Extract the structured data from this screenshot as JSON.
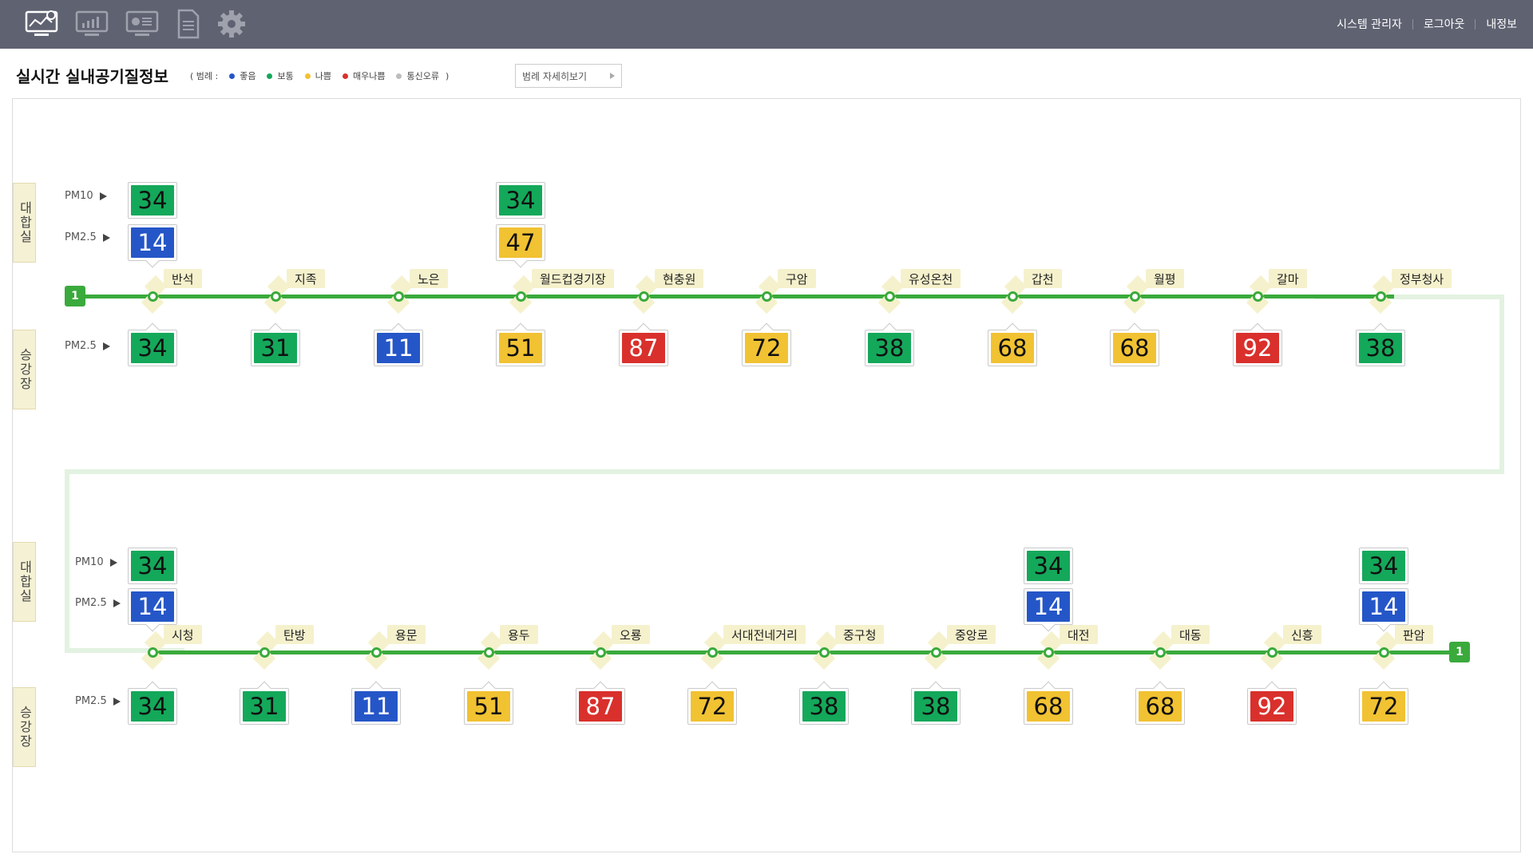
{
  "nav": {
    "icons": [
      "monitor-map-icon",
      "chart-icon",
      "dashboard-icon",
      "document-icon",
      "gear-icon"
    ],
    "user_menu": [
      "시스템 관리자",
      "로그아웃",
      "내정보"
    ]
  },
  "header": {
    "title": "실시간 실내공기질정보",
    "legend_open": "( 범례 :",
    "legend_close": ")",
    "legend": [
      {
        "label": "좋음",
        "color": "#2556c8"
      },
      {
        "label": "보통",
        "color": "#14a85a"
      },
      {
        "label": "나쁨",
        "color": "#f1c232"
      },
      {
        "label": "매우나쁨",
        "color": "#d9302c"
      },
      {
        "label": "통신오류",
        "color": "#bdbdbd"
      }
    ],
    "legend_button": "범례 자세히보기"
  },
  "grade_colors": {
    "good": {
      "bg": "#2556c8",
      "fg": "#ffffff"
    },
    "normal": {
      "bg": "#14a85a",
      "fg": "#111111"
    },
    "bad": {
      "bg": "#f1c232",
      "fg": "#111111"
    },
    "very_bad": {
      "bg": "#d9302c",
      "fg": "#ffffff"
    }
  },
  "labels": {
    "waiting_room": "대합실",
    "platform": "승강장",
    "pm10": "PM10",
    "pm25": "PM2.5",
    "line_number": "1"
  },
  "rows": [
    {
      "stations": [
        {
          "name": "반석",
          "pm10": {
            "v": "34",
            "g": "normal"
          },
          "pm25": {
            "v": "14",
            "g": "good"
          },
          "platform": {
            "v": "34",
            "g": "normal"
          }
        },
        {
          "name": "지족",
          "platform": {
            "v": "31",
            "g": "normal"
          }
        },
        {
          "name": "노은",
          "platform": {
            "v": "11",
            "g": "good"
          }
        },
        {
          "name": "월드컵경기장",
          "pm10": {
            "v": "34",
            "g": "normal"
          },
          "pm25": {
            "v": "47",
            "g": "bad"
          },
          "platform": {
            "v": "51",
            "g": "bad"
          }
        },
        {
          "name": "현충원",
          "platform": {
            "v": "87",
            "g": "very_bad"
          }
        },
        {
          "name": "구암",
          "platform": {
            "v": "72",
            "g": "bad"
          }
        },
        {
          "name": "유성온천",
          "platform": {
            "v": "38",
            "g": "normal"
          }
        },
        {
          "name": "갑천",
          "platform": {
            "v": "68",
            "g": "bad"
          }
        },
        {
          "name": "월평",
          "platform": {
            "v": "68",
            "g": "bad"
          }
        },
        {
          "name": "갈마",
          "platform": {
            "v": "92",
            "g": "very_bad"
          }
        },
        {
          "name": "정부청사",
          "platform": {
            "v": "38",
            "g": "normal"
          }
        }
      ]
    },
    {
      "stations": [
        {
          "name": "시청",
          "pm10": {
            "v": "34",
            "g": "normal"
          },
          "pm25": {
            "v": "14",
            "g": "good"
          },
          "platform": {
            "v": "34",
            "g": "normal"
          }
        },
        {
          "name": "탄방",
          "platform": {
            "v": "31",
            "g": "normal"
          }
        },
        {
          "name": "용문",
          "platform": {
            "v": "11",
            "g": "good"
          }
        },
        {
          "name": "용두",
          "platform": {
            "v": "51",
            "g": "bad"
          }
        },
        {
          "name": "오룡",
          "platform": {
            "v": "87",
            "g": "very_bad"
          }
        },
        {
          "name": "서대전네거리",
          "platform": {
            "v": "72",
            "g": "bad"
          }
        },
        {
          "name": "중구청",
          "platform": {
            "v": "38",
            "g": "normal"
          }
        },
        {
          "name": "중앙로",
          "platform": {
            "v": "38",
            "g": "normal"
          }
        },
        {
          "name": "대전",
          "pm10": {
            "v": "34",
            "g": "normal"
          },
          "pm25": {
            "v": "14",
            "g": "good"
          },
          "platform": {
            "v": "68",
            "g": "bad"
          }
        },
        {
          "name": "대동",
          "platform": {
            "v": "68",
            "g": "bad"
          }
        },
        {
          "name": "신흥",
          "platform": {
            "v": "92",
            "g": "very_bad"
          }
        },
        {
          "name": "판암",
          "pm10": {
            "v": "34",
            "g": "normal"
          },
          "pm25": {
            "v": "14",
            "g": "good"
          },
          "platform": {
            "v": "72",
            "g": "bad"
          }
        }
      ]
    }
  ]
}
